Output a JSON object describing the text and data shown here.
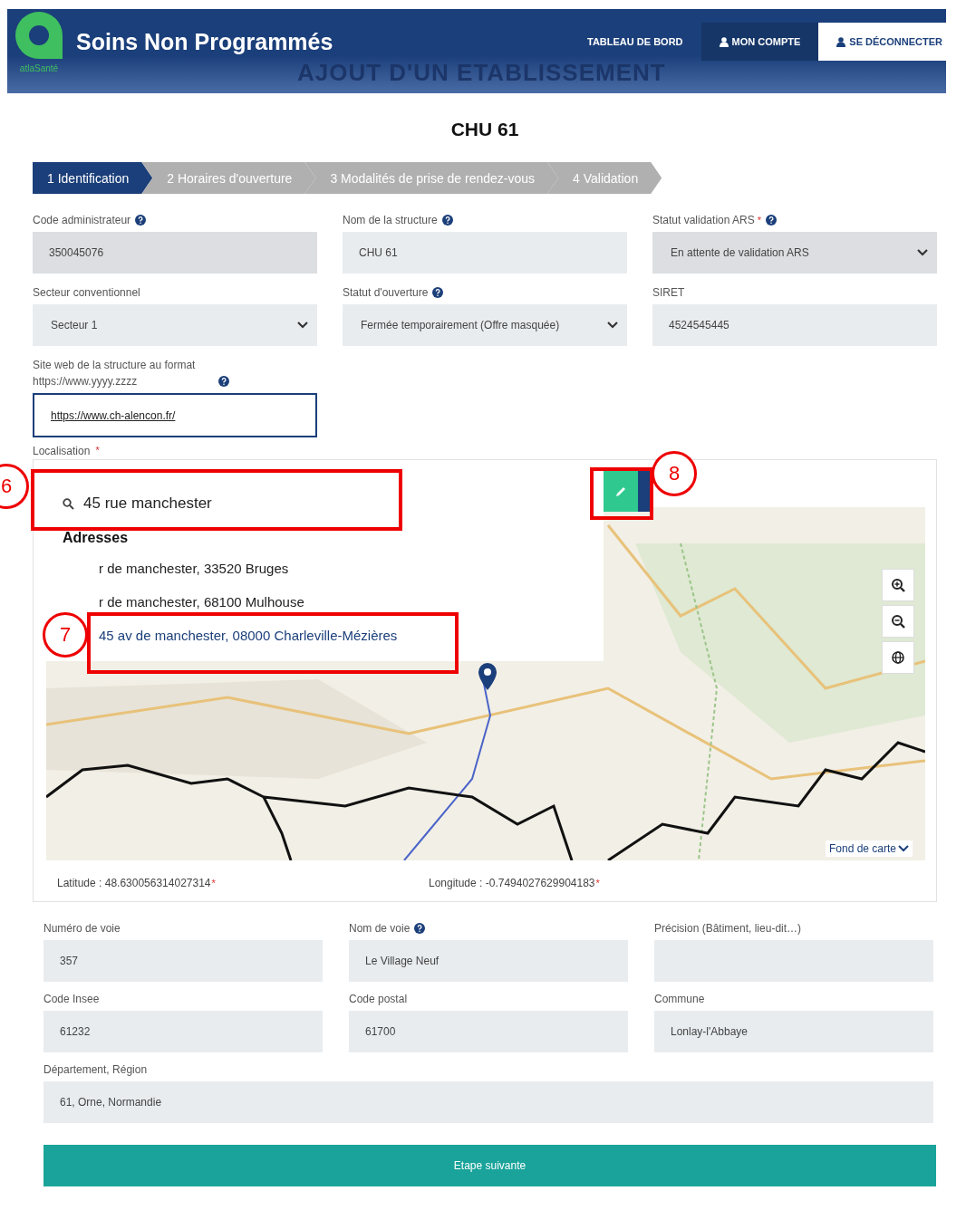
{
  "header": {
    "logo_caption": "atlaSanté",
    "title": "Soins Non Programmés",
    "subtitle": "AJOUT D'UN ETABLISSEMENT",
    "nav": [
      {
        "label": "TABLEAU DE BORD",
        "kind": "link"
      },
      {
        "label": "MON COMPTE",
        "kind": "user-link"
      },
      {
        "label": "SE DÉCONNECTER",
        "kind": "user-button"
      }
    ]
  },
  "heading": "CHU 61",
  "steps": [
    {
      "label": "1 Identification",
      "selected": true
    },
    {
      "label": "2 Horaires d'ouverture",
      "selected": false
    },
    {
      "label": "3 Modalités de prise de rendez-vous",
      "selected": false
    },
    {
      "label": "4 Validation",
      "selected": false
    }
  ],
  "fields": [
    {
      "label": "Code administrateur",
      "help": true,
      "kind": "input",
      "value": "350045076",
      "disabled": true
    },
    {
      "label": "Nom de la structure",
      "help": true,
      "kind": "input",
      "value": "CHU 61",
      "disabled": false
    },
    {
      "label": "Statut validation ARS",
      "required_mark": "*",
      "help": true,
      "kind": "select",
      "value": "En attente de validation ARS",
      "disabled": true
    },
    {
      "label": "Secteur conventionnel",
      "kind": "select",
      "value": "Secteur 1",
      "disabled": false
    },
    {
      "label": "Statut d'ouverture",
      "help": true,
      "kind": "select",
      "value": "Fermée temporairement (Offre masquée)",
      "disabled": false
    },
    {
      "label": "SIRET",
      "kind": "input",
      "value": "4524545445",
      "disabled": false
    },
    {
      "label": "Site web de la structure au format https://www.yyyy.zzzz",
      "help": true,
      "kind": "focused",
      "value": "https://www.ch-alencon.fr/",
      "disabled": false
    }
  ],
  "localisation": {
    "label": "Localisation",
    "required_mark": "*",
    "search": {
      "value": "45 rue manchester"
    },
    "results_heading": "Adresses",
    "results": [
      {
        "label": "r de manchester, 33520 Bruges",
        "selected": false
      },
      {
        "label": "r de manchester, 68100 Mulhouse",
        "selected": false
      },
      {
        "label": "45 av de manchester, 08000 Charleville-Mézières",
        "selected": true
      }
    ],
    "basemap": "Fond de carte",
    "latitude": "Latitude : 48.630056314027314",
    "longitude": "Longitude : -0.7494027629904183",
    "coord_mark": "*"
  },
  "annotations": [
    {
      "number": "6"
    },
    {
      "number": "7"
    },
    {
      "number": "8"
    }
  ],
  "address_fields": [
    {
      "label": "Numéro de voie",
      "value": "357"
    },
    {
      "label": "Nom de voie",
      "help": true,
      "value": "Le Village Neuf"
    },
    {
      "label": "Précision (Bâtiment, lieu-dit…)"
    },
    {
      "label": "Code Insee",
      "value": "61232"
    },
    {
      "label": "Code postal",
      "value": "61700"
    },
    {
      "label": "Commune",
      "value": "Lonlay-l'Abbaye"
    },
    {
      "label": "Département, Région",
      "value": "61, Orne, Normandie",
      "wide": true
    }
  ],
  "next_button": "Etape suivante"
}
